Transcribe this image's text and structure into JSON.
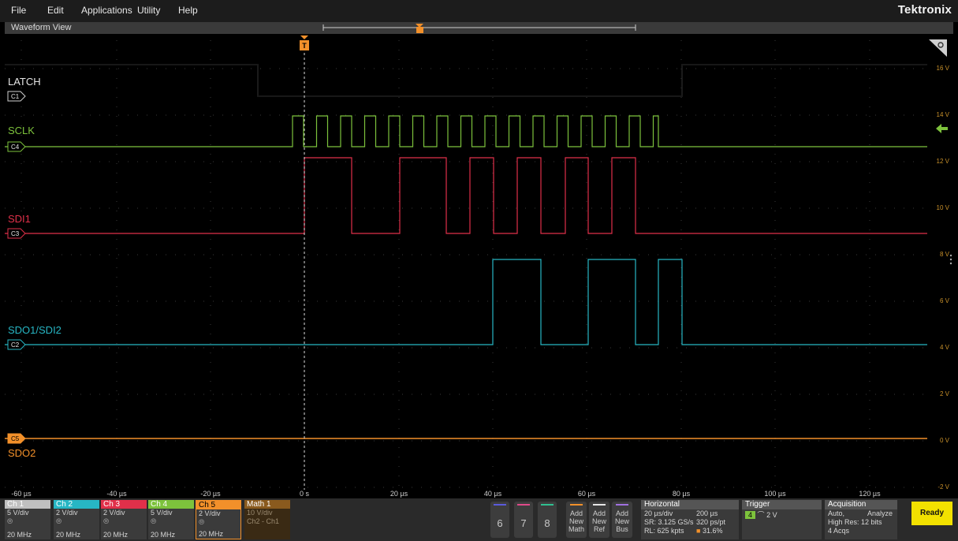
{
  "menu": {
    "items": [
      "File",
      "Edit",
      "Applications",
      "Utility",
      "Help"
    ],
    "brand": "Tektronix"
  },
  "view": {
    "title": "Waveform View"
  },
  "trigger_marker": {
    "label": "T"
  },
  "waveforms": [
    {
      "name": "LATCH",
      "channel": "C1",
      "color": "#1a1a1a",
      "label_color": "#e6e6e6"
    },
    {
      "name": "SCLK",
      "channel": "C4",
      "color": "#7dc23c",
      "label_color": "#7dc23c"
    },
    {
      "name": "SDI1",
      "channel": "C3",
      "color": "#e0304a",
      "label_color": "#e0304a"
    },
    {
      "name": "SDO1/SDI2",
      "channel": "C2",
      "color": "#27b6c4",
      "label_color": "#27b6c4"
    },
    {
      "name": "SDO2",
      "channel": "C5",
      "color": "#f2902a",
      "label_color": "#f2902a"
    }
  ],
  "time_axis": [
    "-60 µs",
    "-40 µs",
    "-20 µs",
    "0 s",
    "20 µs",
    "40 µs",
    "60 µs",
    "80 µs",
    "100 µs",
    "120 µs"
  ],
  "volt_axis": [
    "16 V",
    "14 V",
    "12 V",
    "10 V",
    "8 V",
    "6 V",
    "4 V",
    "2 V",
    "0 V",
    "-2 V"
  ],
  "channel_badges": [
    {
      "title": "Ch 1",
      "scale": "5 V/div",
      "bw": "20 MHz",
      "color": "#c0c0c0"
    },
    {
      "title": "Ch 2",
      "scale": "2 V/div",
      "bw": "20 MHz",
      "color": "#27b6c4"
    },
    {
      "title": "Ch 3",
      "scale": "2 V/div",
      "bw": "20 MHz",
      "color": "#e0304a"
    },
    {
      "title": "Ch 4",
      "scale": "5 V/div",
      "bw": "20 MHz",
      "color": "#7dc23c"
    },
    {
      "title": "Ch 5",
      "scale": "2 V/div",
      "bw": "20 MHz",
      "color": "#f2902a"
    }
  ],
  "math_badge": {
    "title": "Math 1",
    "scale": "10 V/div",
    "expr": "Ch2 - Ch1"
  },
  "dock_channels": [
    {
      "num": "6",
      "color": "#5a5adc"
    },
    {
      "num": "7",
      "color": "#e04a8a"
    },
    {
      "num": "8",
      "color": "#30c090"
    }
  ],
  "add_buttons": [
    {
      "l1": "Add",
      "l2": "New",
      "l3": "Math",
      "color": "#f2902a"
    },
    {
      "l1": "Add",
      "l2": "New",
      "l3": "Ref",
      "color": "#e6e6e6"
    },
    {
      "l1": "Add",
      "l2": "New",
      "l3": "Bus",
      "color": "#a070e0"
    }
  ],
  "horizontal": {
    "title": "Horizontal",
    "scale": "20 µs/div",
    "position": "200 µs",
    "sample_rate": "SR: 3.125 GS/s",
    "resolution": "320 ps/pt",
    "record_length": "RL: 625 kpts",
    "percent": "31.6%"
  },
  "trigger": {
    "title": "Trigger",
    "source": "4",
    "level": "2 V"
  },
  "acquisition": {
    "title": "Acquisition",
    "mode": "Auto,",
    "action": "Analyze",
    "res": "High Res: 12 bits",
    "acqs": "4 Acqs"
  },
  "status": {
    "ready": "Ready"
  }
}
